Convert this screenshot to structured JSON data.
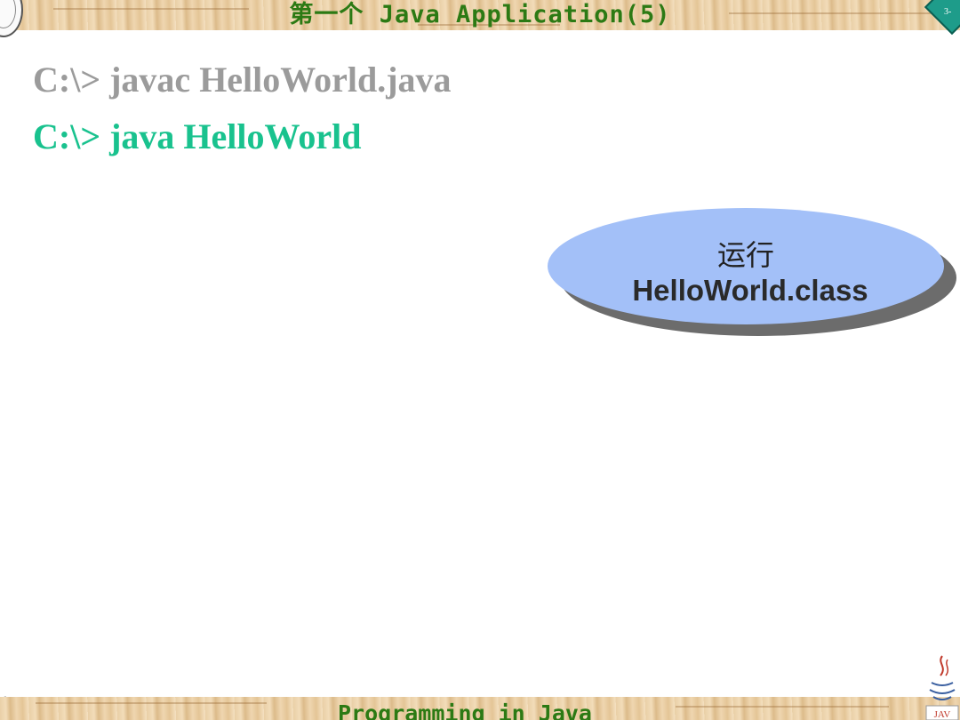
{
  "header": {
    "title": "第一个 Java Application(5)",
    "page_number": "3-"
  },
  "commands": [
    {
      "text": "C:\\> javac HelloWorld.java",
      "color": "#9b9b9b"
    },
    {
      "text": "C:\\> java HelloWorld",
      "color": "#19c28e"
    }
  ],
  "callout": {
    "line1": "运行",
    "line2": "HelloWorld.class",
    "fill_color": "#a3c0f8"
  },
  "footer": {
    "text": "Programming in Java"
  },
  "icons": {
    "seal": "university-seal-icon",
    "page_marker": "page-marker-icon",
    "java_logo": "java-logo-icon",
    "corner_mark": "decorative-mark-icon"
  },
  "colors": {
    "title_green": "#2c7a14",
    "wood_base": "#e9cfa6"
  }
}
